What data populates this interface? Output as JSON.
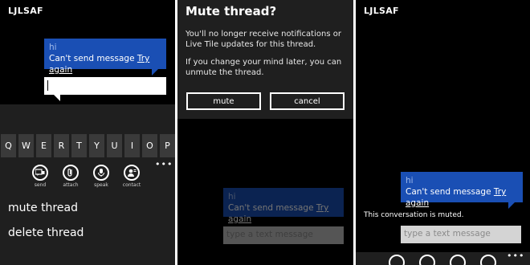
{
  "screen1": {
    "contact": "LJLSAF",
    "bubble": {
      "from": "hi",
      "status": "Can't send message",
      "retry": "Try again"
    },
    "keyboard": {
      "keys": [
        "Q",
        "W",
        "E",
        "R",
        "T",
        "Y",
        "U",
        "I",
        "O",
        "P"
      ]
    },
    "appbar": [
      {
        "label": "send",
        "icon": "send-icon"
      },
      {
        "label": "attach",
        "icon": "attach-icon"
      },
      {
        "label": "speak",
        "icon": "microphone-icon"
      },
      {
        "label": "contact",
        "icon": "contact-icon"
      }
    ],
    "more": "•••",
    "menu": [
      "mute thread",
      "delete thread"
    ]
  },
  "screen2": {
    "dialog": {
      "title": "Mute thread?",
      "text1": "You'll no longer receive notifications or Live Tile updates for this thread.",
      "text2": "If you change your mind later, you can unmute the thread.",
      "mute": "mute",
      "cancel": "cancel"
    },
    "bubble": {
      "from": "hi",
      "status": "Can't send message",
      "retry": "Try again"
    },
    "placeholder": "type a text message"
  },
  "screen3": {
    "contact": "LJLSAF",
    "bubble": {
      "from": "hi",
      "status": "Can't send message",
      "retry": "Try again"
    },
    "muted_note": "This conversation is muted.",
    "placeholder": "type a text message",
    "more": "•••"
  },
  "colors": {
    "accent": "#1a4fb4",
    "background": "#000000",
    "chrome": "#1f1f1f"
  }
}
